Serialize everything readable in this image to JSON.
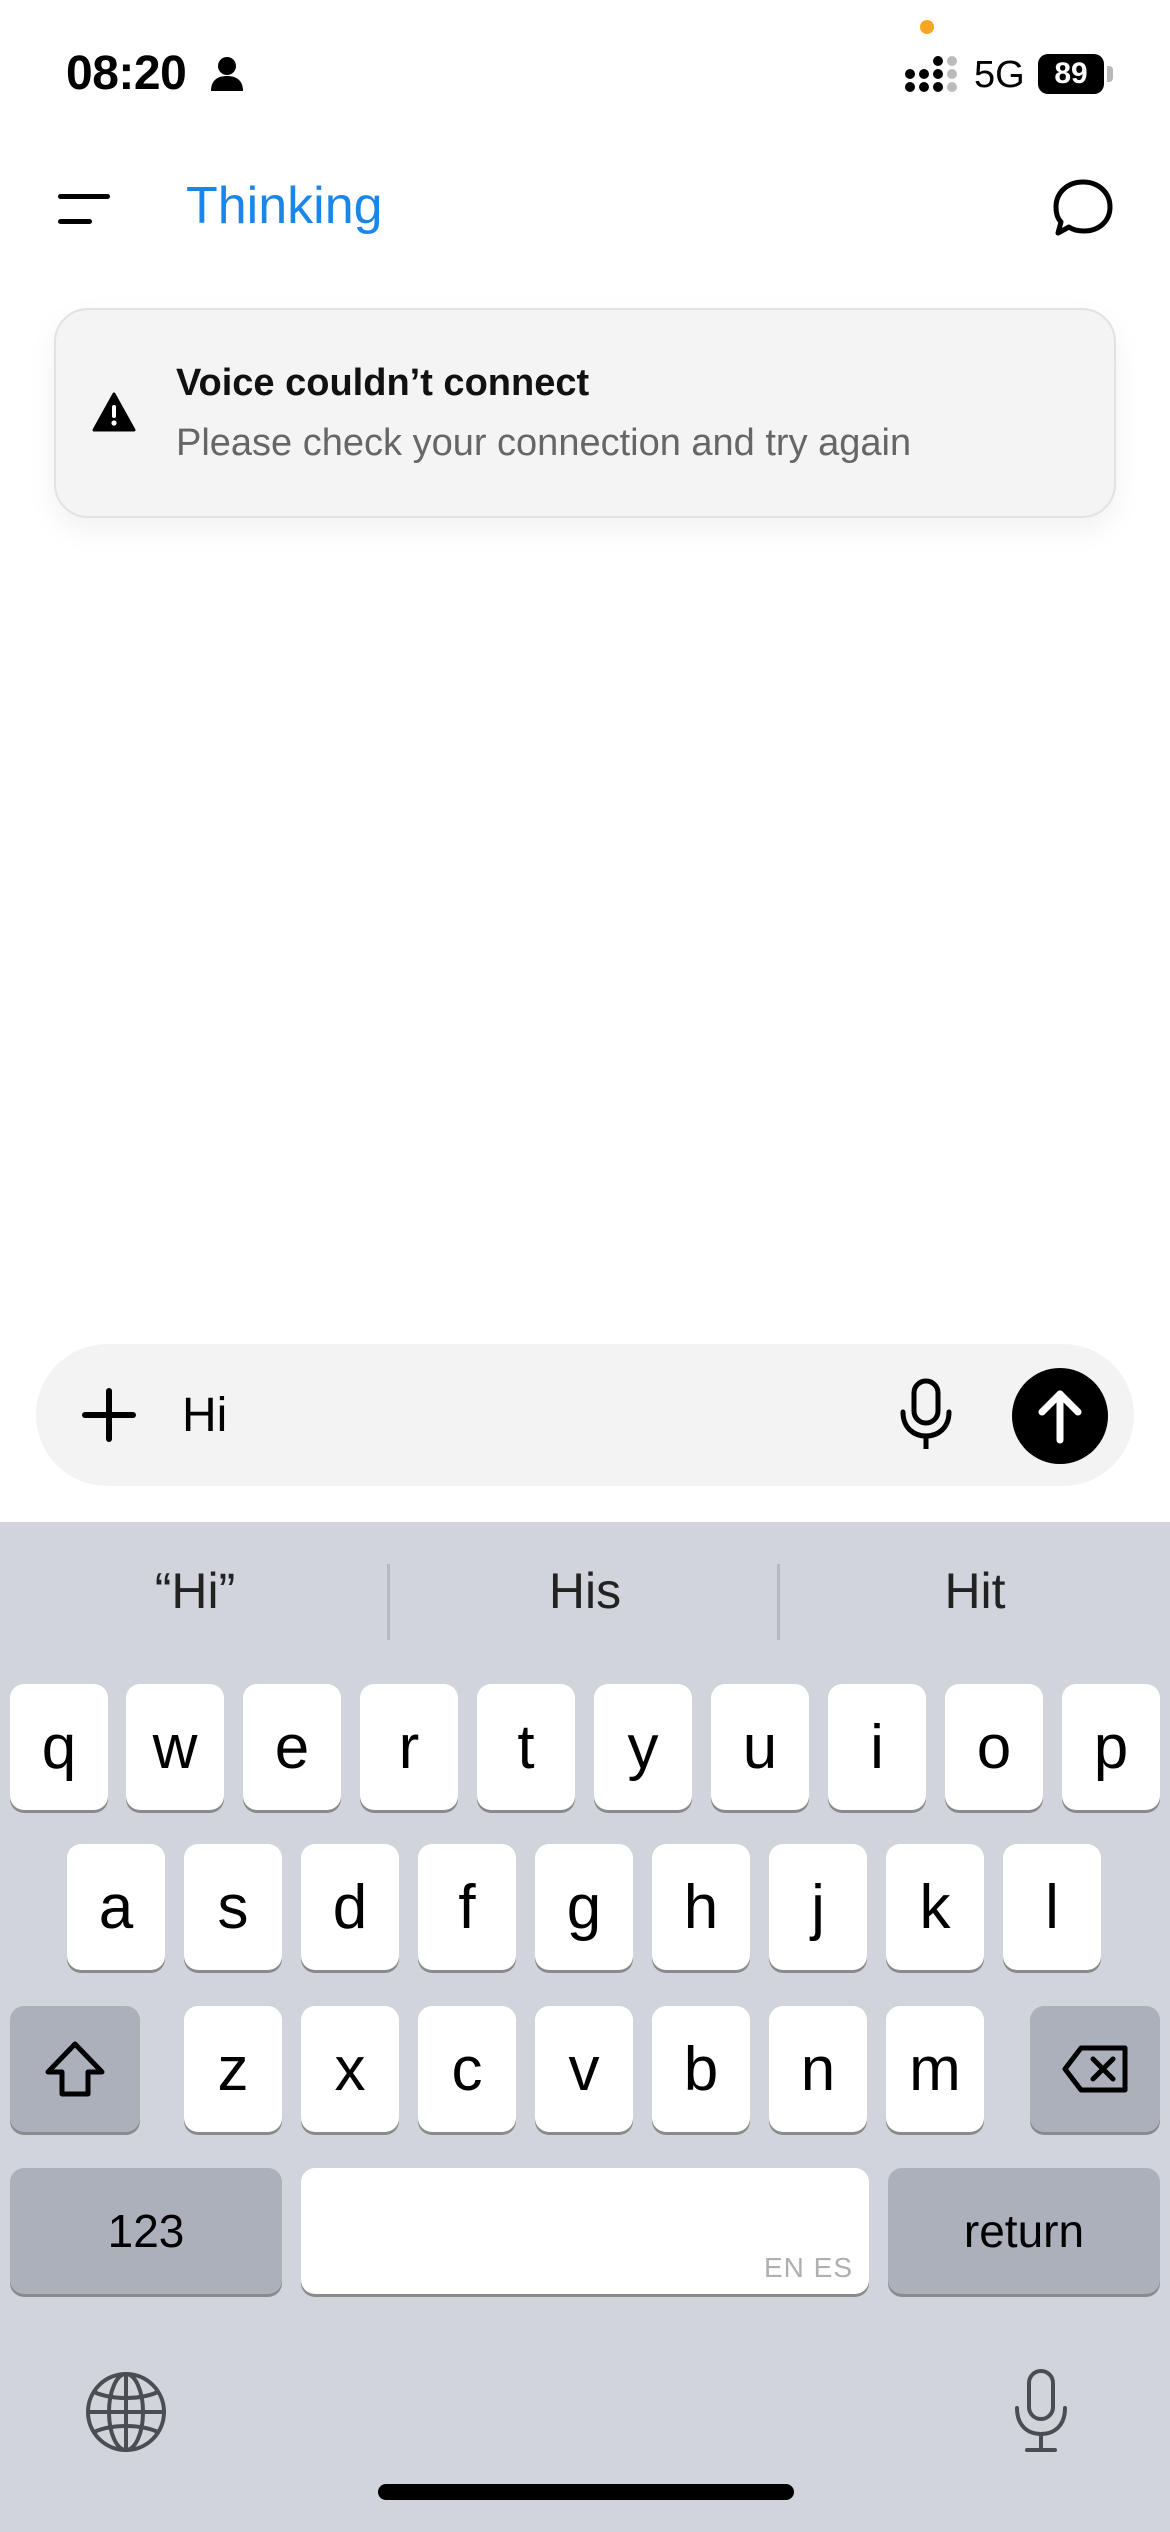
{
  "status_bar": {
    "time": "08:20",
    "network": "5G",
    "battery": "89",
    "privacy_dot_color": "#f5a623"
  },
  "header": {
    "title": "Thinking",
    "title_color": "#1a86e8",
    "menu_icon": "menu-icon",
    "new_chat_icon": "new-chat-icon"
  },
  "toast": {
    "icon": "warning-icon",
    "title": "Voice couldn’t connect",
    "message": "Please check your connection and try again"
  },
  "composer": {
    "value": "Hi",
    "placeholder": "",
    "plus_icon": "plus-icon",
    "mic_icon": "mic-icon",
    "send_icon": "arrow-up-icon"
  },
  "keyboard": {
    "suggestions": [
      "“Hi”",
      "His",
      "Hit"
    ],
    "row1": [
      "q",
      "w",
      "e",
      "r",
      "t",
      "y",
      "u",
      "i",
      "o",
      "p"
    ],
    "row2": [
      "a",
      "s",
      "d",
      "f",
      "g",
      "h",
      "j",
      "k",
      "l"
    ],
    "row3": [
      "z",
      "x",
      "c",
      "v",
      "b",
      "n",
      "m"
    ],
    "numbers_label": "123",
    "space_hint": "EN ES",
    "return_label": "return",
    "globe_icon": "globe-icon",
    "dictation_icon": "dictation-mic-icon"
  }
}
